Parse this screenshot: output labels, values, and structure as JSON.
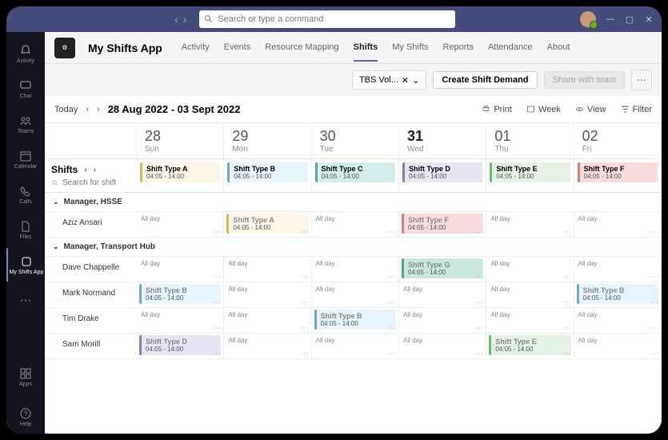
{
  "titlebar": {
    "search_placeholder": "Search or type a command"
  },
  "rail": {
    "items": [
      {
        "label": "Activity",
        "icon": "bell"
      },
      {
        "label": "Chat",
        "icon": "chat"
      },
      {
        "label": "Teams",
        "icon": "teams"
      },
      {
        "label": "Calendar",
        "icon": "calendar"
      },
      {
        "label": "Calls",
        "icon": "calls"
      },
      {
        "label": "Files",
        "icon": "files"
      },
      {
        "label": "My Shifts App",
        "icon": "app",
        "active": true
      }
    ],
    "more_label": "",
    "apps_label": "Apps",
    "help_label": "Help"
  },
  "app": {
    "title": "My Shifts App",
    "tabs": [
      "Activity",
      "Events",
      "Resource Mapping",
      "Shifts",
      "My Shifts",
      "Reports",
      "Attendance",
      "About"
    ],
    "active_tab": "Shifts"
  },
  "toolbar": {
    "chip_label": "TBS Vol...",
    "create_label": "Create Shift Demand",
    "share_label": "Share with team"
  },
  "datebar": {
    "today_label": "Today",
    "range": "28 Aug 2022 - 03 Sept 2022",
    "tools": {
      "print": "Print",
      "week": "Week",
      "view": "View",
      "filter": "Filter"
    }
  },
  "days": [
    {
      "num": "28",
      "dow": "Sun"
    },
    {
      "num": "29",
      "dow": "Mon"
    },
    {
      "num": "30",
      "dow": "Tue"
    },
    {
      "num": "31",
      "dow": "Wed",
      "today": true
    },
    {
      "num": "01",
      "dow": "Thu"
    },
    {
      "num": "02",
      "dow": "Fri"
    }
  ],
  "shifts_hdr": {
    "title": "Shifts",
    "search_placeholder": "Search for shift"
  },
  "shift_types": [
    {
      "name": "Shift Type A",
      "hours": "04:05 - 14:00",
      "cls": "c-a"
    },
    {
      "name": "Shift Type B",
      "hours": "04:05 - 14:00",
      "cls": "c-b"
    },
    {
      "name": "Shift Type C",
      "hours": "04:05 - 14:00",
      "cls": "c-c"
    },
    {
      "name": "Shift Type D",
      "hours": "04:05 - 14:00",
      "cls": "c-d"
    },
    {
      "name": "Shift Type E",
      "hours": "04:05 - 14:00",
      "cls": "c-e"
    },
    {
      "name": "Shift Type F",
      "hours": "04:05 - 14:00",
      "cls": "c-f"
    }
  ],
  "allday_label": "All day",
  "groups": [
    {
      "name": "Manager, HSSE",
      "people": [
        {
          "name": "Aziz Ansari",
          "cells": [
            {
              "allday": true
            },
            {
              "shift": {
                "name": "Shift Type A",
                "hours": "04:05 - 14:00",
                "cls": "c-a"
              }
            },
            {
              "allday": true
            },
            {
              "shift": {
                "name": "Shift Type F",
                "hours": "04:05 - 14:00",
                "cls": "c-f"
              }
            },
            {
              "allday": true
            },
            {
              "allday": true
            }
          ]
        }
      ]
    },
    {
      "name": "Manager, Transport Hub",
      "people": [
        {
          "name": "Dave Chappelle",
          "cells": [
            {
              "allday": true
            },
            {
              "allday": true
            },
            {
              "allday": true
            },
            {
              "shift": {
                "name": "Shift Type G",
                "hours": "04:05 - 14:00",
                "cls": "c-g"
              }
            },
            {
              "allday": true
            },
            {
              "allday": true
            }
          ]
        },
        {
          "name": "Mark Normand",
          "cells": [
            {
              "shift": {
                "name": "Shift Type B",
                "hours": "04:05 - 14:00",
                "cls": "c-b"
              }
            },
            {
              "allday": true
            },
            {
              "allday": true
            },
            {
              "allday": true
            },
            {
              "allday": true
            },
            {
              "shift": {
                "name": "Shift Type B",
                "hours": "04:05 - 14:00",
                "cls": "c-b"
              }
            }
          ]
        },
        {
          "name": "Tim Drake",
          "cells": [
            {
              "allday": true
            },
            {
              "allday": true
            },
            {
              "shift": {
                "name": "Shift Type B",
                "hours": "04:05 - 14:00",
                "cls": "c-b"
              }
            },
            {
              "allday": true
            },
            {
              "allday": true
            },
            {
              "allday": true
            }
          ]
        },
        {
          "name": "Sam Morill",
          "cells": [
            {
              "shift": {
                "name": "Shift Type D",
                "hours": "04:05 - 14:00",
                "cls": "c-d"
              }
            },
            {
              "allday": true
            },
            {
              "allday": true
            },
            {
              "allday": true
            },
            {
              "shift": {
                "name": "Shift Type E",
                "hours": "04:05 - 14:00",
                "cls": "c-e"
              }
            },
            {
              "allday": true
            }
          ]
        }
      ]
    }
  ]
}
